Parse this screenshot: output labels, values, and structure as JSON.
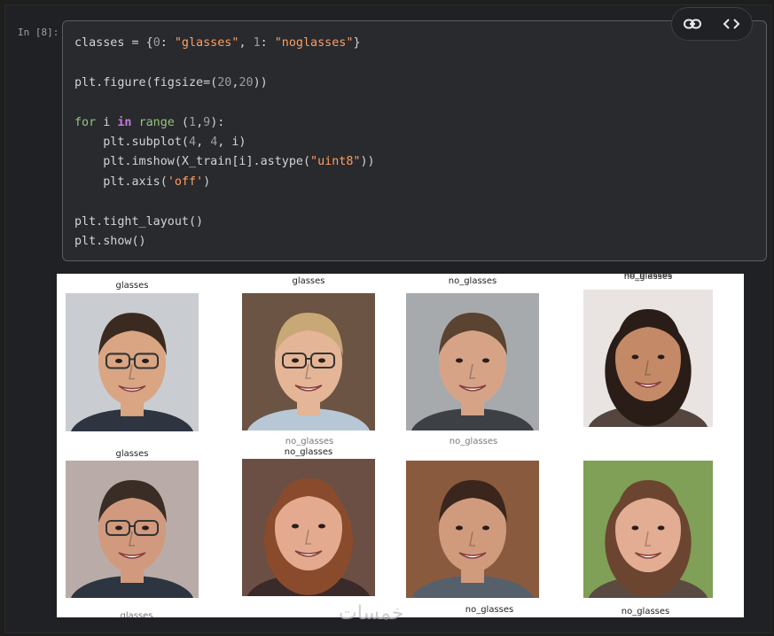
{
  "cell": {
    "prompt": "In [8]:",
    "code_lines": [
      "classes = {0: \"glasses\", 1: \"noglasses\"}",
      "",
      "plt.figure(figsize=(20,20))",
      "",
      "for i in range (1,9):",
      "    plt.subplot(4, 4, i)",
      "    plt.imshow(X_train[i].astype(\"uint8\"))",
      "    plt.axis('off')",
      "",
      "plt.tight_layout()",
      "plt.show()"
    ],
    "toolbar": {
      "link_icon": "link-icon",
      "code_icon": "code-icon"
    }
  },
  "output": {
    "subplots": [
      {
        "title": "glasses",
        "bg": "#c9cdd1",
        "skin": "#d9a583",
        "hair": "#3b2a20",
        "shirt": "#2e3440",
        "glasses": true
      },
      {
        "title": "glasses",
        "bg": "#6b5443",
        "skin": "#e4b596",
        "hair": "#c9a877",
        "shirt": "#b7c7d6",
        "glasses": true
      },
      {
        "title": "no_glasses",
        "bg": "#a7aaad",
        "skin": "#d6a387",
        "hair": "#5a4330",
        "shirt": "#3d4045",
        "glasses": false
      },
      {
        "title": "no_glasses",
        "bg": "#e9e4e1",
        "skin": "#c48a67",
        "hair": "#2a1d18",
        "shirt": "#54463f",
        "glasses": false
      },
      {
        "title": "glasses",
        "bg": "#b9aca8",
        "skin": "#d19a7e",
        "hair": "#3a2d25",
        "shirt": "#2c3540",
        "glasses": true
      },
      {
        "title": "no_glasses",
        "bg": "#6b4f45",
        "skin": "#e3aa8f",
        "hair": "#8a4b2c",
        "shirt": "#3b2a2a",
        "glasses": false
      },
      {
        "title": "",
        "bg": "#8a5a3e",
        "skin": "#d09b7d",
        "hair": "#3a261c",
        "shirt": "#56606b",
        "glasses": false
      },
      {
        "title": "no_glasses",
        "bg": "#7fa056",
        "skin": "#e2ad92",
        "hair": "#6b4530",
        "shirt": "#5a4a40",
        "glasses": false
      }
    ],
    "bottom_labels": [
      "no_glasses",
      "no_glasses"
    ],
    "partial_labels": [
      "no_glasses",
      "no_glasses",
      "no_glasses",
      "glasses"
    ]
  },
  "watermark": "خمسات"
}
